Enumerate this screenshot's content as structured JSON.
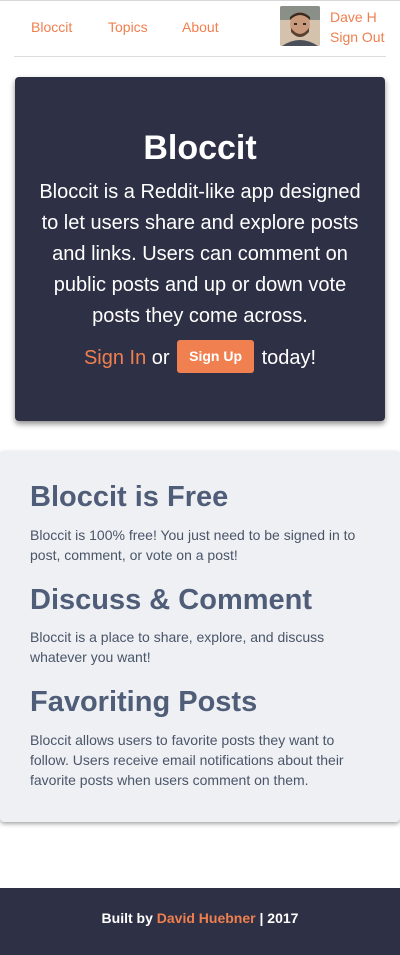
{
  "nav": {
    "brand": "Bloccit",
    "topics": "Topics",
    "about": "About",
    "user_name": "Dave H",
    "sign_out": "Sign Out"
  },
  "hero": {
    "title": "Bloccit",
    "description": "Bloccit is a Reddit-like app designed to let users share and explore posts and links. Users can comment on public posts and up or down vote posts they come across.",
    "sign_in": "Sign In",
    "or": "or",
    "sign_up": "Sign Up",
    "today": "today!"
  },
  "features": [
    {
      "title": "Bloccit is Free",
      "text": "Bloccit is 100% free! You just need to be signed in to post, comment, or vote on a post!"
    },
    {
      "title": "Discuss & Comment",
      "text": "Bloccit is a place to share, explore, and discuss whatever you want!"
    },
    {
      "title": "Favoriting Posts",
      "text": "Bloccit allows users to favorite posts they want to follow. Users receive email notifications about their favorite posts when users comment on them."
    }
  ],
  "footer": {
    "built_by": "Built by",
    "author": "David Huebner",
    "separator": "|",
    "year": "2017"
  },
  "colors": {
    "accent": "#f07f4f",
    "dark": "#2e3145",
    "light_panel": "#eef0f3",
    "heading": "#4f5d78"
  }
}
